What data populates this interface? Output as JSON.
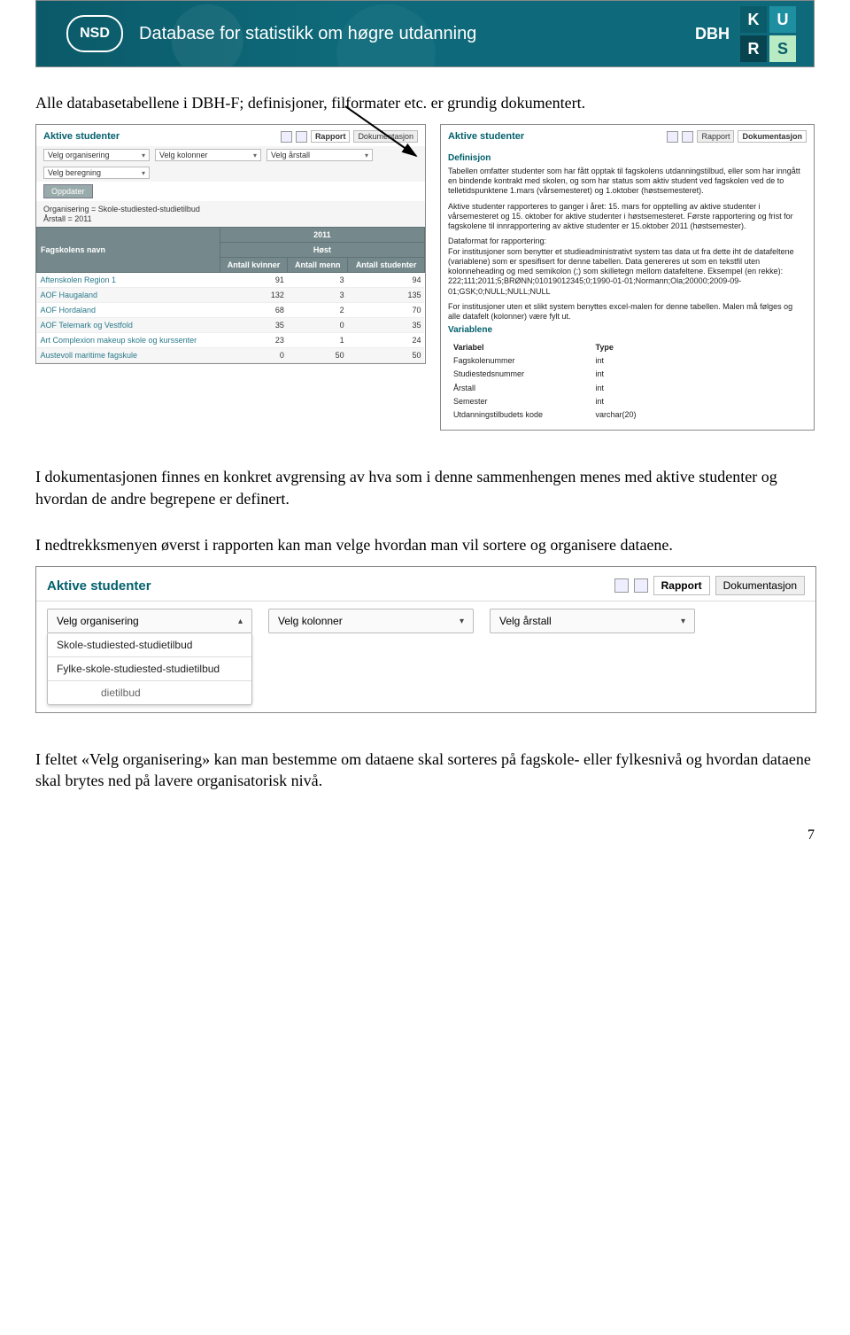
{
  "banner": {
    "logo": "NSD",
    "title": "Database for statistikk om høgre utdanning",
    "dbh": "DBH",
    "tiles": [
      "K",
      "U",
      "R",
      "S"
    ]
  },
  "paragraphs": {
    "p1": "Alle databasetabellene i DBH-F; definisjoner, filformater etc. er grundig dokumentert.",
    "p2": "I dokumentasjonen finnes en konkret avgrensing av hva som i denne sammenhengen menes med aktive studenter og hvordan de andre begrepene er definert.",
    "p3": "I nedtrekksmenyen øverst i rapporten kan man velge hvordan man vil sortere og organisere dataene.",
    "p4": "I feltet «Velg organisering» kan man bestemme om dataene skal sorteres på fagskole- eller fylkesnivå og hvordan dataene skal brytes ned på lavere organisatorisk nivå."
  },
  "mini_left": {
    "title": "Aktive studenter",
    "tab_rapport": "Rapport",
    "tab_dok": "Dokumentasjon",
    "dd_org": "Velg organisering",
    "dd_kol": "Velg kolonner",
    "dd_ar": "Velg årstall",
    "dd_ber": "Velg beregning",
    "btn_update": "Oppdater",
    "applied_org_label": "Organisering = Skole-studiested-studietilbud",
    "applied_ar_label": "Årstall = 2011",
    "thead_year": "2011",
    "thead_sem": "Høst",
    "th_name": "Fagskolens navn",
    "th_kvinner": "Antall kvinner",
    "th_menn": "Antall menn",
    "th_stud": "Antall studenter",
    "rows": [
      {
        "name": "Aftenskolen Region 1",
        "k": "91",
        "m": "3",
        "s": "94"
      },
      {
        "name": "AOF Haugaland",
        "k": "132",
        "m": "3",
        "s": "135"
      },
      {
        "name": "AOF Hordaland",
        "k": "68",
        "m": "2",
        "s": "70"
      },
      {
        "name": "AOF Telemark og Vestfold",
        "k": "35",
        "m": "0",
        "s": "35"
      },
      {
        "name": "Art Complexion makeup skole og kurssenter",
        "k": "23",
        "m": "1",
        "s": "24"
      },
      {
        "name": "Austevoll maritime fagskule",
        "k": "0",
        "m": "50",
        "s": "50"
      }
    ]
  },
  "mini_right": {
    "title": "Aktive studenter",
    "tab_rapport": "Rapport",
    "tab_dok": "Dokumentasjon",
    "def_heading": "Definisjon",
    "def_p1": "Tabellen omfatter studenter som har fått opptak til fagskolens utdanningstilbud, eller som har inngått en bindende kontrakt med skolen, og som har status som aktiv student ved fagskolen ved de to telletidspunktene 1.mars (vårsemesteret) og 1.oktober (høstsemesteret).",
    "def_p2": "Aktive studenter rapporteres to ganger i året: 15. mars for opptelling av aktive studenter i vårsemesteret og 15. oktober for aktive studenter i høstsemesteret. Første rapportering og frist for fagskolene til innrapportering av aktive studenter er 15.oktober 2011 (høstsemester).",
    "def_p3_head": "Dataformat for rapportering:",
    "def_p3": "For institusjoner som benytter et studieadministrativt system tas data ut fra dette iht de datafeltene (variablene) som er spesifisert for denne tabellen. Data genereres ut som en tekstfil uten kolonneheading og med semikolon (;) som skilletegn mellom datafeltene. Eksempel (en rekke): 222;111;2011;5;BRØNN;01019012345;0;1990-01-01;Normann;Ola;20000;2009-09-01;GSK;0;NULL;NULL;NULL",
    "def_p4": "For institusjoner uten et slikt system benyttes excel-malen for denne tabellen. Malen må følges og alle datafelt (kolonner) være fylt ut.",
    "variables_heading": "Variablene",
    "th_var": "Variabel",
    "th_type": "Type",
    "vars": [
      {
        "v": "Fagskolenummer",
        "t": "int"
      },
      {
        "v": "Studiestedsnummer",
        "t": "int"
      },
      {
        "v": "Årstall",
        "t": "int"
      },
      {
        "v": "Semester",
        "t": "int"
      },
      {
        "v": "Utdanningstilbudets kode",
        "t": "varchar(20)"
      }
    ]
  },
  "full": {
    "title": "Aktive studenter",
    "tab_rapport": "Rapport",
    "tab_dok": "Dokumentasjon",
    "dd_org": "Velg organisering",
    "dd_kol": "Velg kolonner",
    "dd_ar": "Velg årstall",
    "opt1": "Skole-studiested-studietilbud",
    "opt2": "Fylke-skole-studiested-studietilbud",
    "opt3": "dietilbud"
  },
  "page_number": "7"
}
